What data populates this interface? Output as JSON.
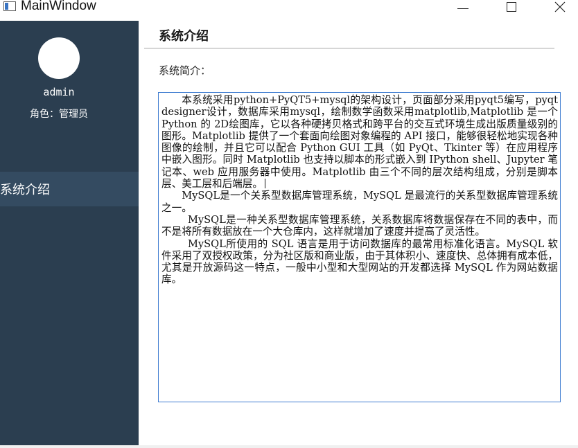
{
  "window": {
    "title": "MainWindow",
    "controls": [
      "minimize",
      "maximize",
      "close"
    ]
  },
  "sidebar": {
    "username": "admin",
    "role": "角色：管理员",
    "nav_items": [
      {
        "label": "系统介绍",
        "selected": true
      }
    ]
  },
  "main": {
    "title": "系统介绍",
    "intro_label": "系统简介：",
    "paragraphs": [
      "本系统采用python+PyQT5+mysql的架构设计，页面部分采用pyqt5编写，pyqtdesigner设计，数据库采用mysql，绘制数学函数采用matplotlib,Matplotlib 是一个 Python 的 2D绘图库，它以各种硬拷贝格式和跨平台的交互式环境生成出版质量级别的图形。Matplotlib 提供了一个套面向绘图对象编程的 API 接口，能够很轻松地实现各种图像的绘制，并且它可以配合 Python GUI 工具（如 PyQt、Tkinter 等）在应用程序中嵌入图形。同时 Matplotlib 也支持以脚本的形式嵌入到 IPython shell、Jupyter 笔记本、web 应用服务器中使用。Matplotlib 由三个不同的层次结构组成，分别是脚本层、美工层和后端层。",
      "MySQL是一个关系型数据库管理系统，MySQL 是最流行的关系型数据库管理系统之一。",
      "MySQL是一种关系型数据库管理系统，关系数据库将数据保存在不同的表中，而不是将所有数据放在一个大仓库内，这样就增加了速度并提高了灵活性。",
      "MySQL所使用的 SQL 语言是用于访问数据库的最常用标准化语言。MySQL 软件采用了双授权政策，分为社区版和商业版，由于其体积小、速度快、总体拥有成本低，尤其是开放源码这一特点，一般中小型和大型网站的开发都选择 MySQL 作为网站数据库。"
    ]
  },
  "colors": {
    "sidebar_bg": "#2b3e50",
    "nav_selected_bg": "#344b61",
    "textbox_border": "#3d7bd0"
  }
}
